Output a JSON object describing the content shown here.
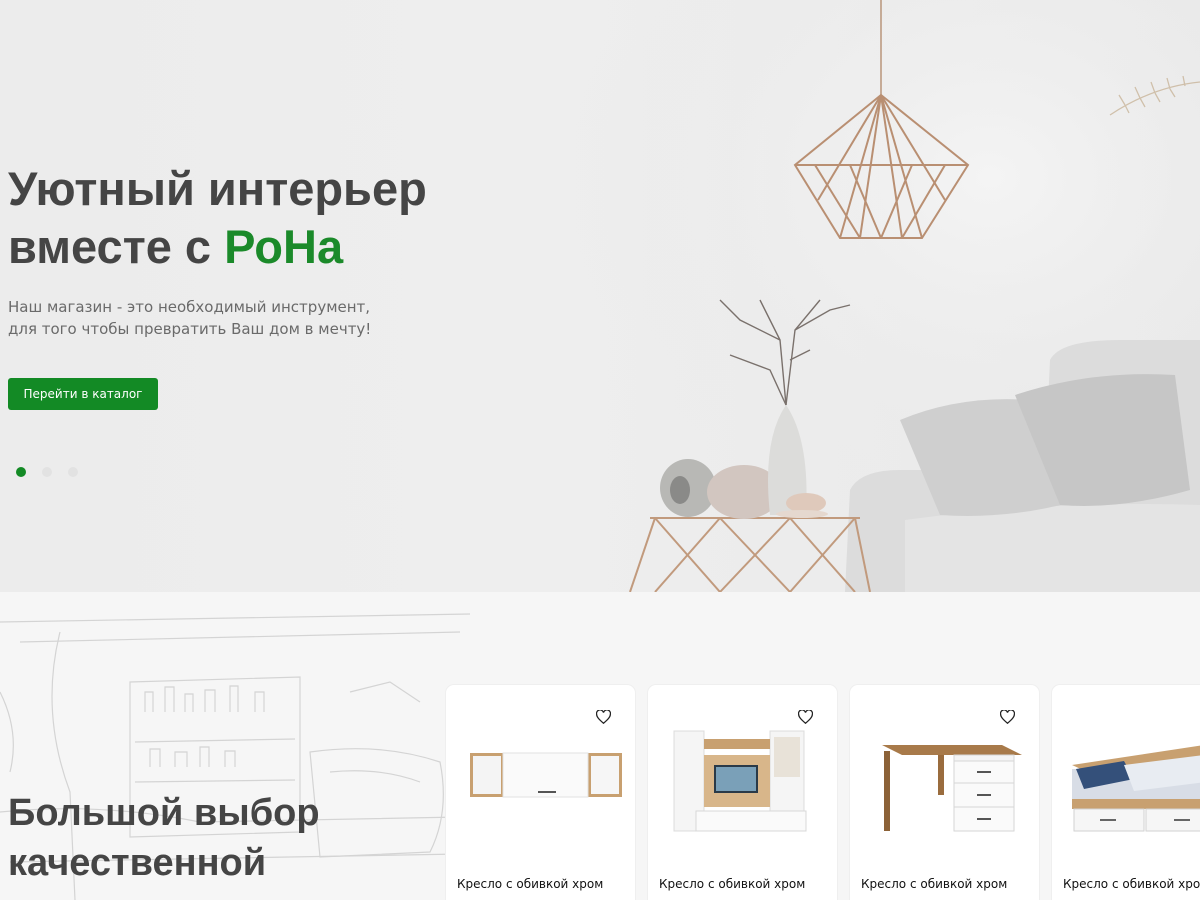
{
  "hero": {
    "title_line1": "Уютный интерьер",
    "title_line2_prefix": "вместе с ",
    "brand": "РоНа",
    "subtitle_line1": "Наш магазин - это необходимый инструмент,",
    "subtitle_line2": "для того чтобы превратить Ваш дом в мечту!",
    "cta_label": "Перейти в каталог",
    "slides_total": 3,
    "slide_active": 1
  },
  "section": {
    "title_line1": "Большой выбор",
    "title_line2": "качественной"
  },
  "products": [
    {
      "name": "Кресло с обивкой хром",
      "image": "wall-cabinet",
      "icon": "heart-icon"
    },
    {
      "name": "Кресло с обивкой хром",
      "image": "tv-wall-unit",
      "icon": "heart-icon"
    },
    {
      "name": "Кресло с обивкой хром",
      "image": "desk",
      "icon": "heart-icon"
    },
    {
      "name": "Кресло с обивкой хром",
      "image": "bed-with-drawers",
      "icon": "heart-icon"
    }
  ],
  "colors": {
    "accent": "#138a25",
    "brand_text": "#1b8a2a",
    "heading": "#454545",
    "hero_bg": "#ececec",
    "section_bg": "#f6f6f6"
  }
}
